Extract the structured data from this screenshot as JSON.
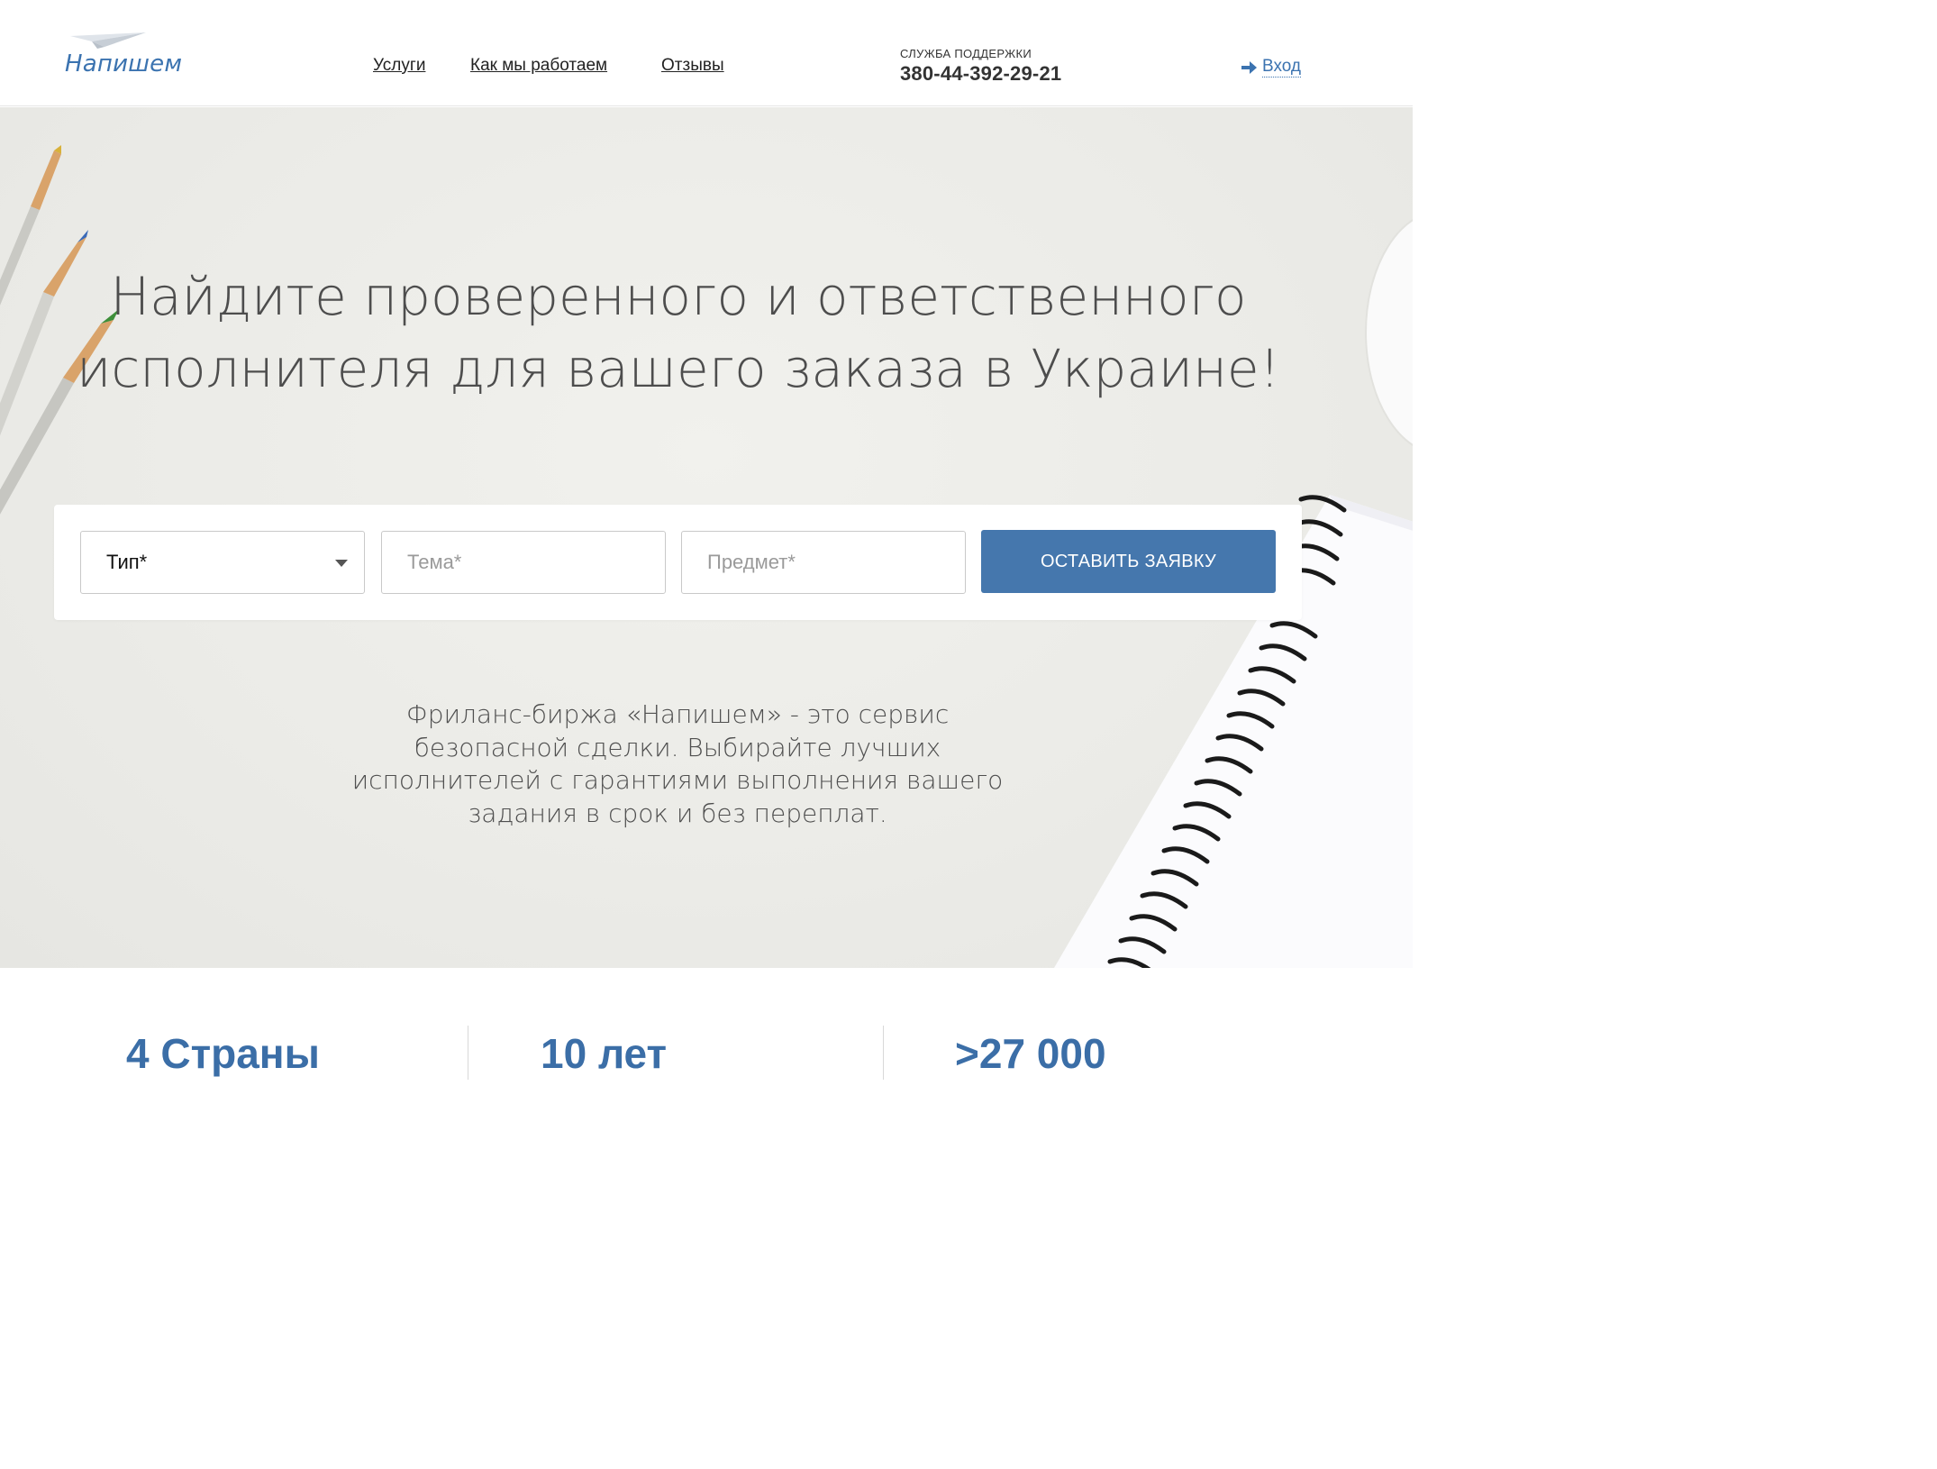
{
  "header": {
    "logo_text": "Напишем",
    "nav": [
      {
        "label": "Услуги"
      },
      {
        "label": "Как мы работаем"
      },
      {
        "label": "Отзывы"
      }
    ],
    "support_label": "СЛУЖБА ПОДДЕРЖКИ",
    "support_phone": "380-44-392-29-21",
    "login_label": "Вход"
  },
  "hero": {
    "title_line1": "Найдите проверенного и ответственного",
    "title_line2": "исполнителя для вашего заказа в Украине!",
    "form": {
      "type_label": "Тип*",
      "topic_placeholder": "Тема*",
      "subject_placeholder": "Предмет*",
      "submit_label": "ОСТАВИТЬ ЗАЯВКУ"
    },
    "description": "Фриланс-биржа «Напишем» - это сервис безопасной сделки. Выбирайте лучших исполнителей с гарантиями выполнения вашего задания в срок и без переплат."
  },
  "stats": [
    {
      "label": "4 Страны"
    },
    {
      "label": "10 лет"
    },
    {
      "label": ">27 000"
    }
  ],
  "colors": {
    "brand_blue": "#4577ad",
    "text_dark": "#4d4d4d"
  },
  "icons": {
    "logo": "paper-plane-icon",
    "login": "arrow-right-icon",
    "select": "caret-down-icon"
  }
}
